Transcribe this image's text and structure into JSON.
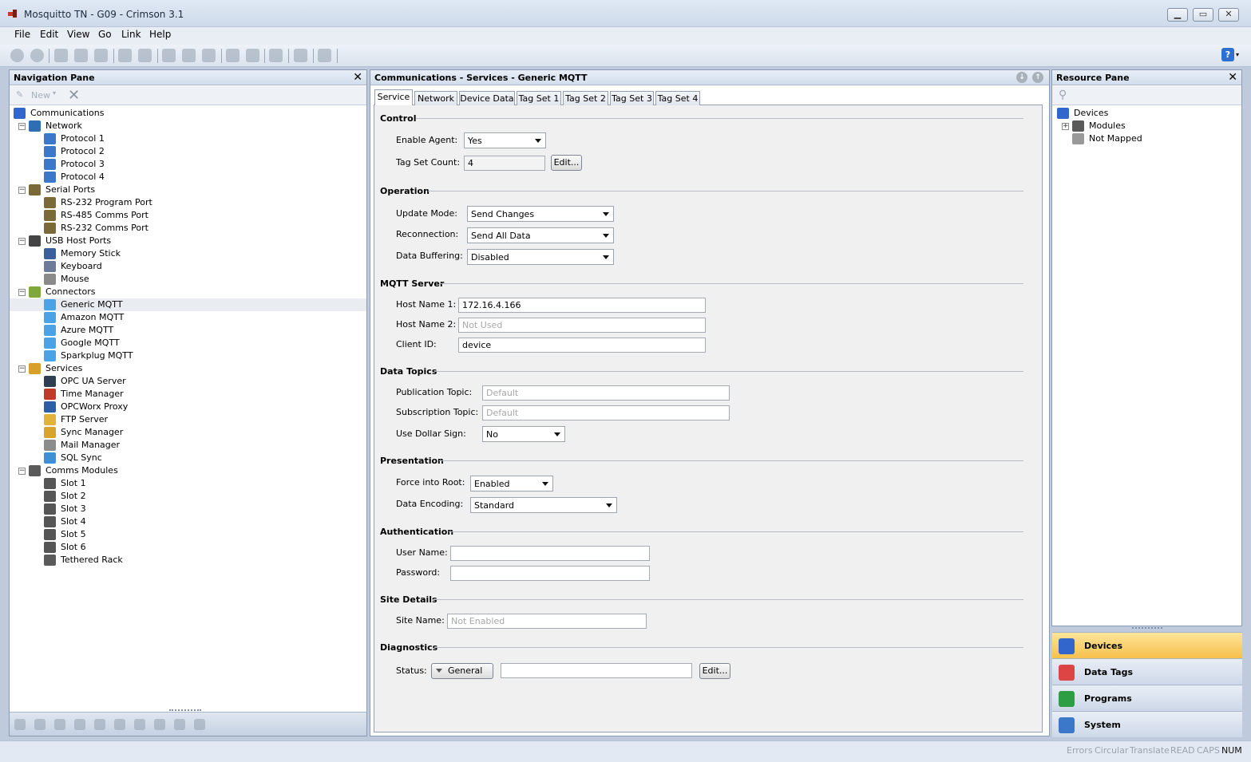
{
  "window": {
    "title": "Mosquitto TN - G09 - Crimson 3.1"
  },
  "menu": [
    "File",
    "Edit",
    "View",
    "Go",
    "Link",
    "Help"
  ],
  "nav_pane": {
    "title": "Navigation Pane",
    "new_label": "New",
    "tree": [
      {
        "label": "Communications",
        "icon": "communications-icon",
        "level": 0
      },
      {
        "label": "Network",
        "icon": "network-icon",
        "level": 1,
        "expander": "−"
      },
      {
        "label": "Protocol 1",
        "icon": "protocol-icon",
        "level": 2
      },
      {
        "label": "Protocol 2",
        "icon": "protocol-icon",
        "level": 2
      },
      {
        "label": "Protocol 3",
        "icon": "protocol-icon",
        "level": 2
      },
      {
        "label": "Protocol 4",
        "icon": "protocol-icon",
        "level": 2
      },
      {
        "label": "Serial Ports",
        "icon": "serial-port-icon",
        "level": 1,
        "expander": "−"
      },
      {
        "label": "RS-232 Program Port",
        "icon": "serial-port-icon",
        "level": 2
      },
      {
        "label": "RS-485 Comms Port",
        "icon": "serial-port-icon",
        "level": 2
      },
      {
        "label": "RS-232 Comms Port",
        "icon": "serial-port-icon",
        "level": 2
      },
      {
        "label": "USB Host Ports",
        "icon": "usb-icon",
        "level": 1,
        "expander": "−"
      },
      {
        "label": "Memory Stick",
        "icon": "memory-stick-icon",
        "level": 2
      },
      {
        "label": "Keyboard",
        "icon": "keyboard-icon",
        "level": 2
      },
      {
        "label": "Mouse",
        "icon": "mouse-icon",
        "level": 2
      },
      {
        "label": "Connectors",
        "icon": "connectors-icon",
        "level": 1,
        "expander": "−"
      },
      {
        "label": "Generic MQTT",
        "icon": "cloud-icon",
        "level": 2,
        "selected": true
      },
      {
        "label": "Amazon MQTT",
        "icon": "cloud-icon",
        "level": 2
      },
      {
        "label": "Azure MQTT",
        "icon": "cloud-icon",
        "level": 2
      },
      {
        "label": "Google MQTT",
        "icon": "cloud-icon",
        "level": 2
      },
      {
        "label": "Sparkplug MQTT",
        "icon": "cloud-icon",
        "level": 2
      },
      {
        "label": "Services",
        "icon": "services-icon",
        "level": 1,
        "expander": "−"
      },
      {
        "label": "OPC UA Server",
        "icon": "opc-ua-icon",
        "level": 2
      },
      {
        "label": "Time Manager",
        "icon": "clock-icon",
        "level": 2
      },
      {
        "label": "OPCWorx Proxy",
        "icon": "proxy-icon",
        "level": 2
      },
      {
        "label": "FTP Server",
        "icon": "folder-icon",
        "level": 2
      },
      {
        "label": "Sync Manager",
        "icon": "sync-icon",
        "level": 2
      },
      {
        "label": "Mail Manager",
        "icon": "mail-icon",
        "level": 2
      },
      {
        "label": "SQL Sync",
        "icon": "sql-icon",
        "level": 2
      },
      {
        "label": "Comms Modules",
        "icon": "rack-icon",
        "level": 1,
        "expander": "−"
      },
      {
        "label": "Slot 1",
        "icon": "slot-icon",
        "level": 2
      },
      {
        "label": "Slot 2",
        "icon": "slot-icon",
        "level": 2
      },
      {
        "label": "Slot 3",
        "icon": "slot-icon",
        "level": 2
      },
      {
        "label": "Slot 4",
        "icon": "slot-icon",
        "level": 2
      },
      {
        "label": "Slot 5",
        "icon": "slot-icon",
        "level": 2
      },
      {
        "label": "Slot 6",
        "icon": "slot-icon",
        "level": 2
      },
      {
        "label": "Tethered Rack",
        "icon": "rack-icon",
        "level": 2
      }
    ]
  },
  "editor": {
    "title": "Communications - Services - Generic MQTT",
    "tabs": [
      "Service",
      "Network",
      "Device Data",
      "Tag Set 1",
      "Tag Set 2",
      "Tag Set 3",
      "Tag Set 4"
    ],
    "active_tab": "Service",
    "sections": {
      "control": "Control",
      "operation": "Operation",
      "mqtt_server": "MQTT Server",
      "data_topics": "Data Topics",
      "presentation": "Presentation",
      "authentication": "Authentication",
      "site_details": "Site Details",
      "diagnostics": "Diagnostics"
    },
    "fields": {
      "enable_agent": {
        "label": "Enable Agent:",
        "value": "Yes"
      },
      "tag_set_count": {
        "label": "Tag Set Count:",
        "value": "4",
        "button": "Edit..."
      },
      "update_mode": {
        "label": "Update Mode:",
        "value": "Send Changes"
      },
      "reconnection": {
        "label": "Reconnection:",
        "value": "Send All Data"
      },
      "data_buffering": {
        "label": "Data Buffering:",
        "value": "Disabled"
      },
      "host_name_1": {
        "label": "Host Name 1:",
        "value": "172.16.4.166"
      },
      "host_name_2": {
        "label": "Host Name 2:",
        "value": "Not Used"
      },
      "client_id": {
        "label": "Client ID:",
        "value": "device"
      },
      "publication_topic": {
        "label": "Publication Topic:",
        "value": "Default"
      },
      "subscription_topic": {
        "label": "Subscription Topic:",
        "value": "Default"
      },
      "use_dollar_sign": {
        "label": "Use Dollar Sign:",
        "value": "No"
      },
      "force_into_root": {
        "label": "Force into Root:",
        "value": "Enabled"
      },
      "data_encoding": {
        "label": "Data Encoding:",
        "value": "Standard"
      },
      "user_name": {
        "label": "User Name:",
        "value": ""
      },
      "password": {
        "label": "Password:",
        "value": ""
      },
      "site_name": {
        "label": "Site Name:",
        "value": "Not Enabled"
      },
      "status": {
        "label": "Status:",
        "menu": "General",
        "value": "",
        "button": "Edit..."
      }
    }
  },
  "resource_pane": {
    "title": "Resource Pane",
    "tree": [
      {
        "label": "Devices",
        "icon": "devices-icon",
        "level": 0
      },
      {
        "label": "Modules",
        "icon": "rack-icon",
        "level": 1,
        "expander": "+"
      },
      {
        "label": "Not Mapped",
        "icon": "question-icon",
        "level": 1
      }
    ],
    "nav_buttons": [
      {
        "label": "Devices",
        "icon": "devices-icon",
        "active": true
      },
      {
        "label": "Data Tags",
        "icon": "data-tags-icon",
        "active": false
      },
      {
        "label": "Programs",
        "icon": "programs-icon",
        "active": false
      },
      {
        "label": "System",
        "icon": "system-icon",
        "active": false
      }
    ]
  },
  "status_bar": {
    "items": [
      {
        "label": "Errors",
        "on": false
      },
      {
        "label": "Circular",
        "on": false
      },
      {
        "label": "Translate",
        "on": false
      },
      {
        "label": "READ",
        "on": false
      },
      {
        "label": "CAPS",
        "on": false
      },
      {
        "label": "NUM",
        "on": true
      }
    ]
  },
  "colors": {
    "accent": "#f7c04a",
    "frame": "#bfcbdd",
    "header": "#d3deec"
  }
}
